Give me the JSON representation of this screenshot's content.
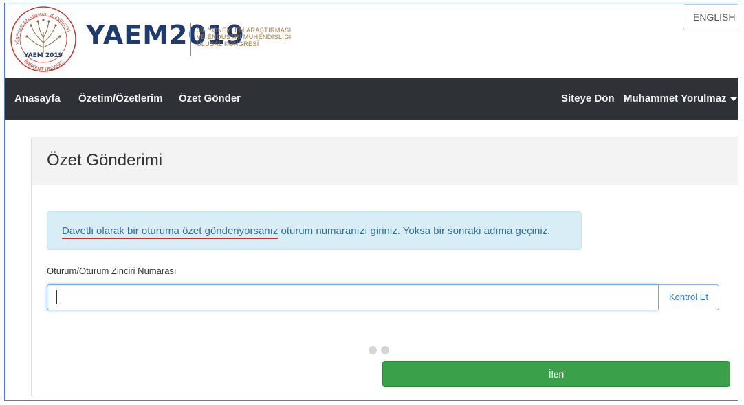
{
  "header": {
    "brand": "YAEM2019",
    "subtitle_lines": [
      "39. YÖNEYLEM ARAŞTIRMASI",
      "VE ENDÜSTRİ MÜHENDİSLİĞİ",
      "ULUSAL KONGRESİ"
    ],
    "seal_text": "YAEM 2019",
    "seal_university": "BAŞKENT ÜNİVERSİTESİ",
    "language_button": "ENGLISH (E"
  },
  "navbar": {
    "items": [
      "Anasayfa",
      "Özetim/Özetlerim",
      "Özet Gönder"
    ],
    "right_items": [
      "Siteye Dön"
    ],
    "user": "Muhammet Yorulmaz"
  },
  "panel": {
    "title": "Özet Gönderimi",
    "alert_underlined": "Davetli olarak bir oturuma özet gönderiyorsanız",
    "alert_rest": " oturum numaranızı giriniz. Yoksa bir sonraki adıma geçiniz.",
    "field_label": "Oturum/Oturum Zinciri Numarası",
    "field_value": "",
    "check_button": "Kontrol Et",
    "next_button": "İleri"
  },
  "colors": {
    "navbar_bg": "#2e3237",
    "brand_blue": "#1f3b6e",
    "brand_gold": "#a5773e",
    "alert_bg": "#d9edf7",
    "alert_text": "#31708f",
    "primary_green": "#3aa14a"
  }
}
